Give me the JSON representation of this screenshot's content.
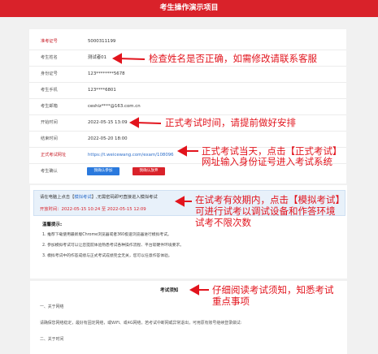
{
  "header": {
    "title": "考生操作演示项目"
  },
  "info": {
    "rows": [
      {
        "label": "准考证号",
        "value": "5000311199",
        "red": true
      },
      {
        "label": "考生姓名",
        "value": "测试者01"
      },
      {
        "label": "身份证号",
        "value": "123********5678"
      },
      {
        "label": "考生手机",
        "value": "123****6801"
      },
      {
        "label": "考生邮箱",
        "value": "ceshiz****@163.com.cn"
      },
      {
        "label": "开始时间",
        "value": "2022-05-15 13:09"
      },
      {
        "label": "结束时间",
        "value": "2022-05-20 18:00"
      },
      {
        "label": "正式考试网址",
        "value": "https://t.weicewang.com/exam/108096",
        "red": true,
        "link": true
      },
      {
        "label": "考生确认",
        "value": ""
      }
    ],
    "confirm_label": "我确认参加",
    "abandon_label": "我确认放弃"
  },
  "annotations": {
    "name": "检查姓名是否正确，如需修改请联系客服",
    "time": "正式考试时间，请提前做好安排",
    "url_1": "正式考试当天，点击【正式考试】",
    "url_2": "网址输入身份证号进入考试系统",
    "mock_1": "在试考有效期内，点击【模拟考试】",
    "mock_2": "可进行试考以调试设备和作答环境",
    "mock_3": "试考不限次数",
    "notice": "仔细阅读考试须知，知悉考试",
    "notice_2": "重点事项"
  },
  "mock": {
    "text_a": "请在电脑上点击【",
    "link": "模拟考试",
    "text_b": "】,无需密码即可直接进入模拟考试",
    "time": "开放时间：2022-05-15 10:24 至 2022-05-15 12:09",
    "tips_title": "温馨提示:",
    "tips": [
      "1. 推荐下载使用最新版Chrome浏览器或者360极速浏览器进行模拟考试。",
      "2. 参加模拟考试可以让您提前体验熟悉考试各种操作流程、平台软硬件环境要求。",
      "3. 模拟考试中的作答成绩与正式考试成绩完全无关，您可以任意作答体验。"
    ]
  },
  "notice": {
    "title": "考试须知",
    "line1": "一、关于网络",
    "line2": "请确保您网络稳定，最好有固定网络，或WiFi、或4G网络，若考试中断网或异常退出，可用原有账号继续登录做试:",
    "line3": "二、关于时间"
  }
}
